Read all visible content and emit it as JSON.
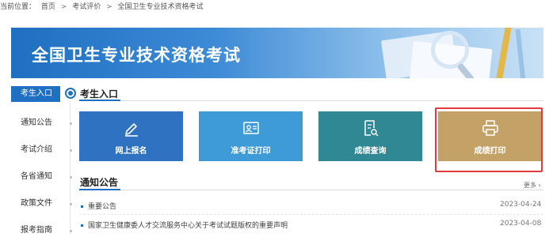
{
  "breadcrumb": {
    "prefix": "当前位置：",
    "items": [
      "首页",
      "考试评价",
      "全国卫生专业技术资格考试"
    ],
    "separator": ">"
  },
  "banner": {
    "title": "全国卫生专业技术资格考试"
  },
  "sidebar": {
    "items": [
      {
        "label": "考生入口",
        "active": true
      },
      {
        "label": "通知公告"
      },
      {
        "label": "考试介绍"
      },
      {
        "label": "各省通知"
      },
      {
        "label": "政策文件"
      },
      {
        "label": "报考指南"
      }
    ]
  },
  "entrance": {
    "title": "考生入口",
    "cards": [
      {
        "label": "网上报名",
        "icon": "edit-pen-icon",
        "color": "#2f72c1"
      },
      {
        "label": "准考证打印",
        "icon": "id-card-icon",
        "color": "#3f9ad8"
      },
      {
        "label": "成绩查询",
        "icon": "document-search-icon",
        "color": "#2f8893"
      },
      {
        "label": "成绩打印",
        "icon": "printer-icon",
        "color": "#c4a267"
      }
    ]
  },
  "notices": {
    "title": "通知公告",
    "more_label": "更多",
    "items": [
      {
        "title": "重要公告",
        "date": "2023-04-24"
      },
      {
        "title": "国家卫生健康委人才交流服务中心关于考试试题版权的重要声明",
        "date": "2023-04-08"
      }
    ]
  },
  "colors": {
    "accent": "#1f6fc2",
    "highlight_border": "#e23b3b"
  }
}
